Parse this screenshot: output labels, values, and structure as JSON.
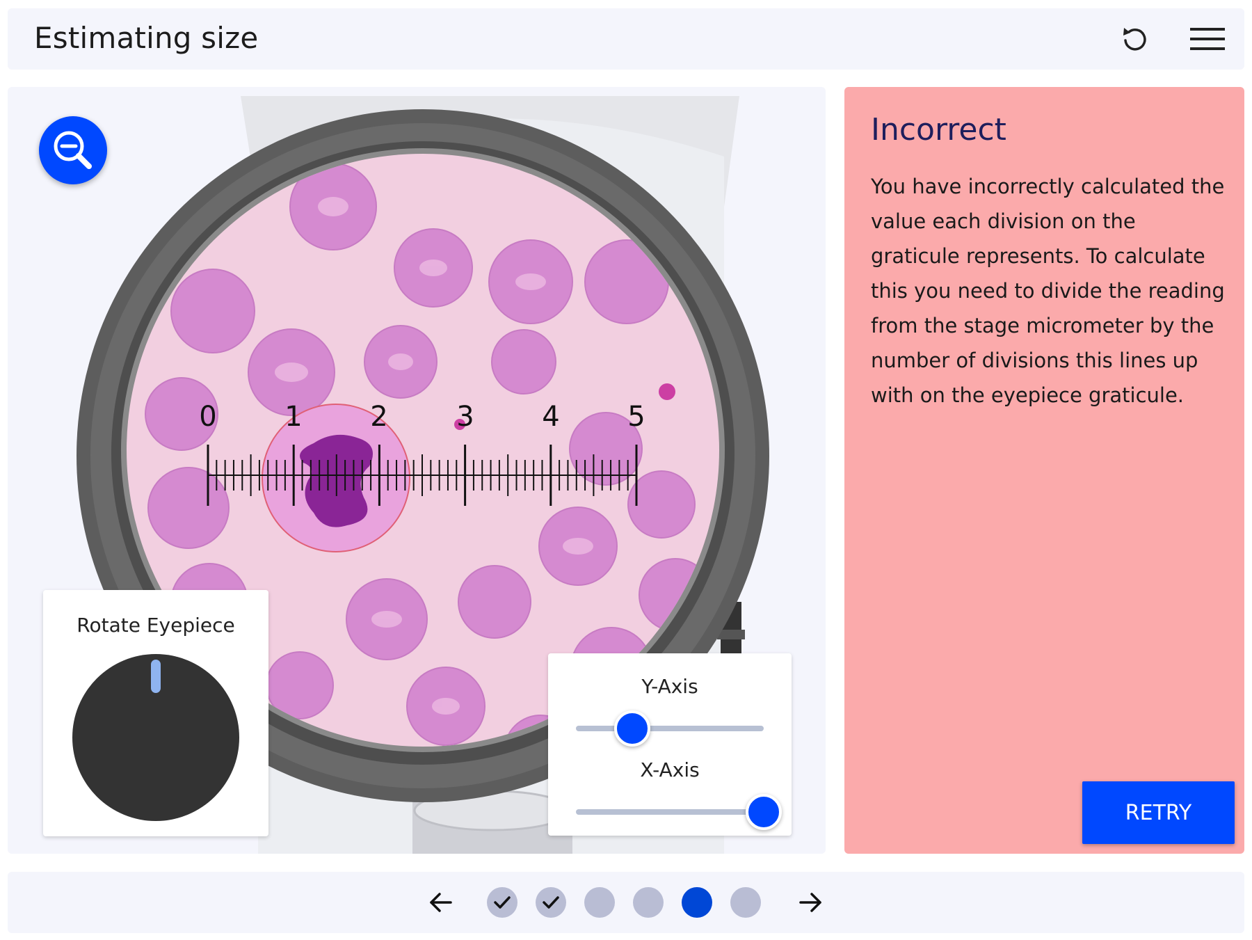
{
  "header": {
    "title": "Estimating size",
    "reset_icon": "reset-icon",
    "menu_icon": "hamburger-menu-icon"
  },
  "microscope": {
    "zoom_icon": "zoom-out-icon",
    "graticule_numbers": [
      "0",
      "1",
      "2",
      "3",
      "4",
      "5"
    ],
    "colors": {
      "slide_background": "#f2cfe0",
      "red_cell": "#d58ad0",
      "neutrophil_nucleus": "#8a2596",
      "eyepiece_ring": "#666666"
    }
  },
  "rotate_eyepiece": {
    "label": "Rotate Eyepiece"
  },
  "stage_controls": {
    "y_axis_label": "Y-Axis",
    "x_axis_label": "X-Axis",
    "y_axis_value": 0.3,
    "x_axis_value": 1.0
  },
  "feedback": {
    "title": "Incorrect",
    "body": "You have incorrectly calculated the value each division on the graticule represents. To calculate this you need to divide the reading from the stage micrometer by the number of divisions this lines up with on the eyepiece graticule.",
    "retry_label": "RETRY",
    "background": "#fbaaab"
  },
  "pagination": {
    "prev_icon": "arrow-left-icon",
    "next_icon": "arrow-right-icon",
    "steps": [
      {
        "state": "completed",
        "icon": "checkmark-icon"
      },
      {
        "state": "completed",
        "icon": "checkmark-icon"
      },
      {
        "state": "pending"
      },
      {
        "state": "pending"
      },
      {
        "state": "current"
      },
      {
        "state": "pending"
      }
    ]
  },
  "colors": {
    "accent": "#0048ff",
    "panel_background": "#f4f5fc",
    "dot_inactive": "#b9bdd4",
    "dot_current": "#0047d6"
  }
}
